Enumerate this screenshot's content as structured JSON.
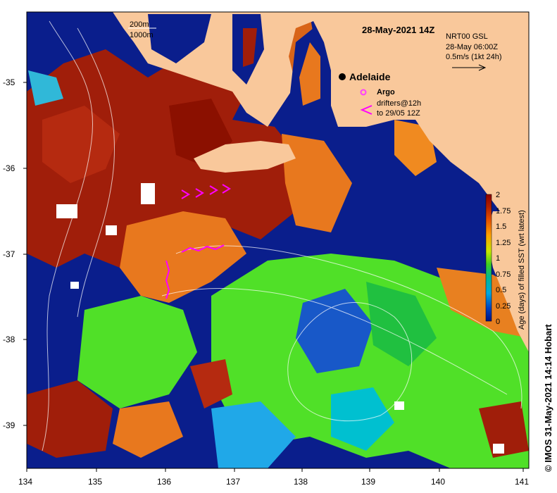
{
  "title": "28-May-2021 14Z",
  "depth_legend": [
    "200m",
    "1000m"
  ],
  "current_legend": {
    "line1": "NRT00 GSL",
    "line2": "28-May 06:00Z",
    "line3": "0.5m/s (1kt 24h)"
  },
  "place": "Adelaide",
  "argo_label": "Argo",
  "drifters_label": {
    "line1": "drifters@12h",
    "line2": "to 29/05 12Z"
  },
  "y_ticks": [
    "-35",
    "-36",
    "-37",
    "-38",
    "-39"
  ],
  "x_ticks": [
    "134",
    "135",
    "136",
    "137",
    "138",
    "139",
    "140",
    "141"
  ],
  "colorbar": {
    "label": "Age (days) of filled SST (wrt latest)",
    "ticks": [
      "2",
      "1.75",
      "1.5",
      "1.25",
      "1",
      "0.75",
      "0.5",
      "0.25",
      "0"
    ],
    "colors": [
      "#8b0000",
      "#b22000",
      "#e65000",
      "#ffa000",
      "#c8e800",
      "#40d020",
      "#00b890",
      "#00a8e0",
      "#0040c0",
      "#001080"
    ]
  },
  "credit": "© IMOS 31-May-2021 14:14 Hobart",
  "colors": {
    "land": "#f9c89b",
    "ocean_recent": "#0a1e8c",
    "old": "#a01e0a",
    "mid": "#e8781e",
    "fresh": "#50e028",
    "argo": "#ff40ff",
    "drifter": "#ff00ff"
  }
}
